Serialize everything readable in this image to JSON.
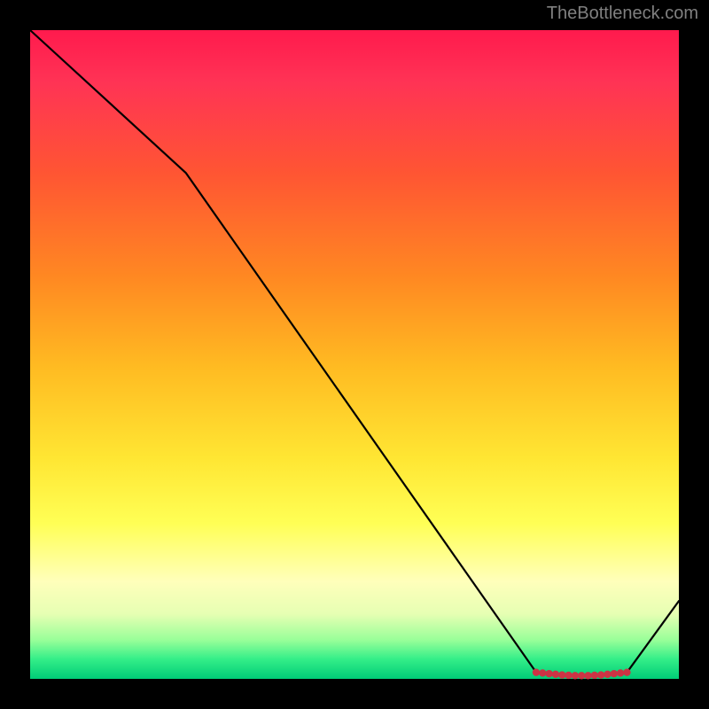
{
  "attribution": "TheBottleneck.com",
  "chart_data": {
    "type": "line",
    "title": "",
    "xlabel": "",
    "ylabel": "",
    "xlim": [
      0,
      100
    ],
    "ylim": [
      0,
      100
    ],
    "x": [
      0,
      24,
      78,
      80,
      82,
      84,
      86,
      88,
      90,
      92,
      100
    ],
    "values": [
      100,
      78,
      1,
      0.8,
      0.6,
      0.5,
      0.5,
      0.6,
      0.8,
      1,
      12
    ],
    "markers": {
      "color": "#cc3344",
      "x": [
        78,
        79,
        80,
        81,
        82,
        83,
        84,
        85,
        86,
        87,
        88,
        89,
        90,
        91,
        92
      ],
      "y": [
        1.0,
        0.9,
        0.8,
        0.7,
        0.6,
        0.55,
        0.5,
        0.5,
        0.5,
        0.55,
        0.6,
        0.7,
        0.8,
        0.9,
        1.0
      ]
    },
    "gradient_stops": [
      {
        "pos": 0,
        "color": "#ff1a4d"
      },
      {
        "pos": 8,
        "color": "#ff3355"
      },
      {
        "pos": 22,
        "color": "#ff5533"
      },
      {
        "pos": 38,
        "color": "#ff8822"
      },
      {
        "pos": 52,
        "color": "#ffbb22"
      },
      {
        "pos": 66,
        "color": "#ffe633"
      },
      {
        "pos": 76,
        "color": "#ffff55"
      },
      {
        "pos": 85,
        "color": "#ffffbb"
      },
      {
        "pos": 90,
        "color": "#e6ffb3"
      },
      {
        "pos": 94,
        "color": "#99ff99"
      },
      {
        "pos": 97,
        "color": "#33ee88"
      },
      {
        "pos": 100,
        "color": "#00cc77"
      }
    ]
  }
}
